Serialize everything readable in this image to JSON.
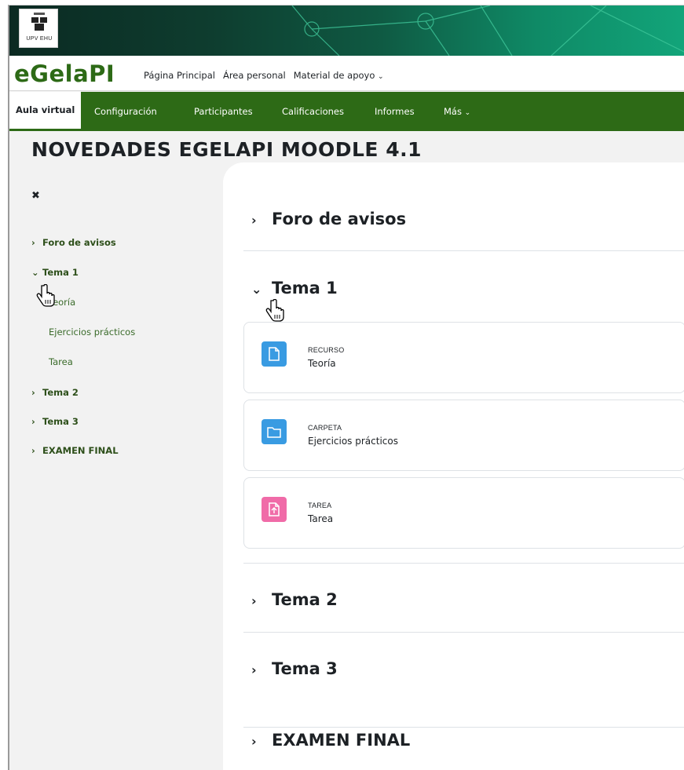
{
  "colors": {
    "brand_green": "#2d6a16",
    "resource_blue": "#399be2",
    "assign_pink": "#f06ba8"
  },
  "banner": {
    "logo_text": "UPV   EHU"
  },
  "navbar": {
    "brand": "eGelaPI",
    "links": [
      "Página Principal",
      "Área personal",
      "Material de apoyo"
    ]
  },
  "secnav": {
    "tabs": [
      "Aula virtual",
      "Configuración",
      "Participantes",
      "Calificaciones",
      "Informes",
      "Más"
    ],
    "active": "Aula virtual"
  },
  "page": {
    "title": "NOVEDADES EGELAPI MOODLE 4.1"
  },
  "course_index": {
    "items": [
      {
        "label": "Foro de avisos",
        "expanded": false
      },
      {
        "label": "Tema 1",
        "expanded": true
      },
      {
        "label": "Teoría"
      },
      {
        "label": "Ejercicios prácticos"
      },
      {
        "label": "Tarea"
      },
      {
        "label": "Tema 2",
        "expanded": false
      },
      {
        "label": "Tema 3",
        "expanded": false
      },
      {
        "label": "EXAMEN FINAL",
        "expanded": false
      }
    ]
  },
  "sections": [
    {
      "title": "Foro de avisos",
      "expanded": false
    },
    {
      "title": "Tema 1",
      "expanded": true
    },
    {
      "title": "Tema 2",
      "expanded": false
    },
    {
      "title": "Tema 3",
      "expanded": false
    },
    {
      "title": "EXAMEN FINAL",
      "expanded": false
    }
  ],
  "activities": [
    {
      "type": "RECURSO",
      "name": "Teoría",
      "icon": "file-icon"
    },
    {
      "type": "CARPETA",
      "name": "Ejercicios prácticos",
      "icon": "folder-icon"
    },
    {
      "type": "TAREA",
      "name": "Tarea",
      "icon": "assignment-upload-icon"
    }
  ]
}
